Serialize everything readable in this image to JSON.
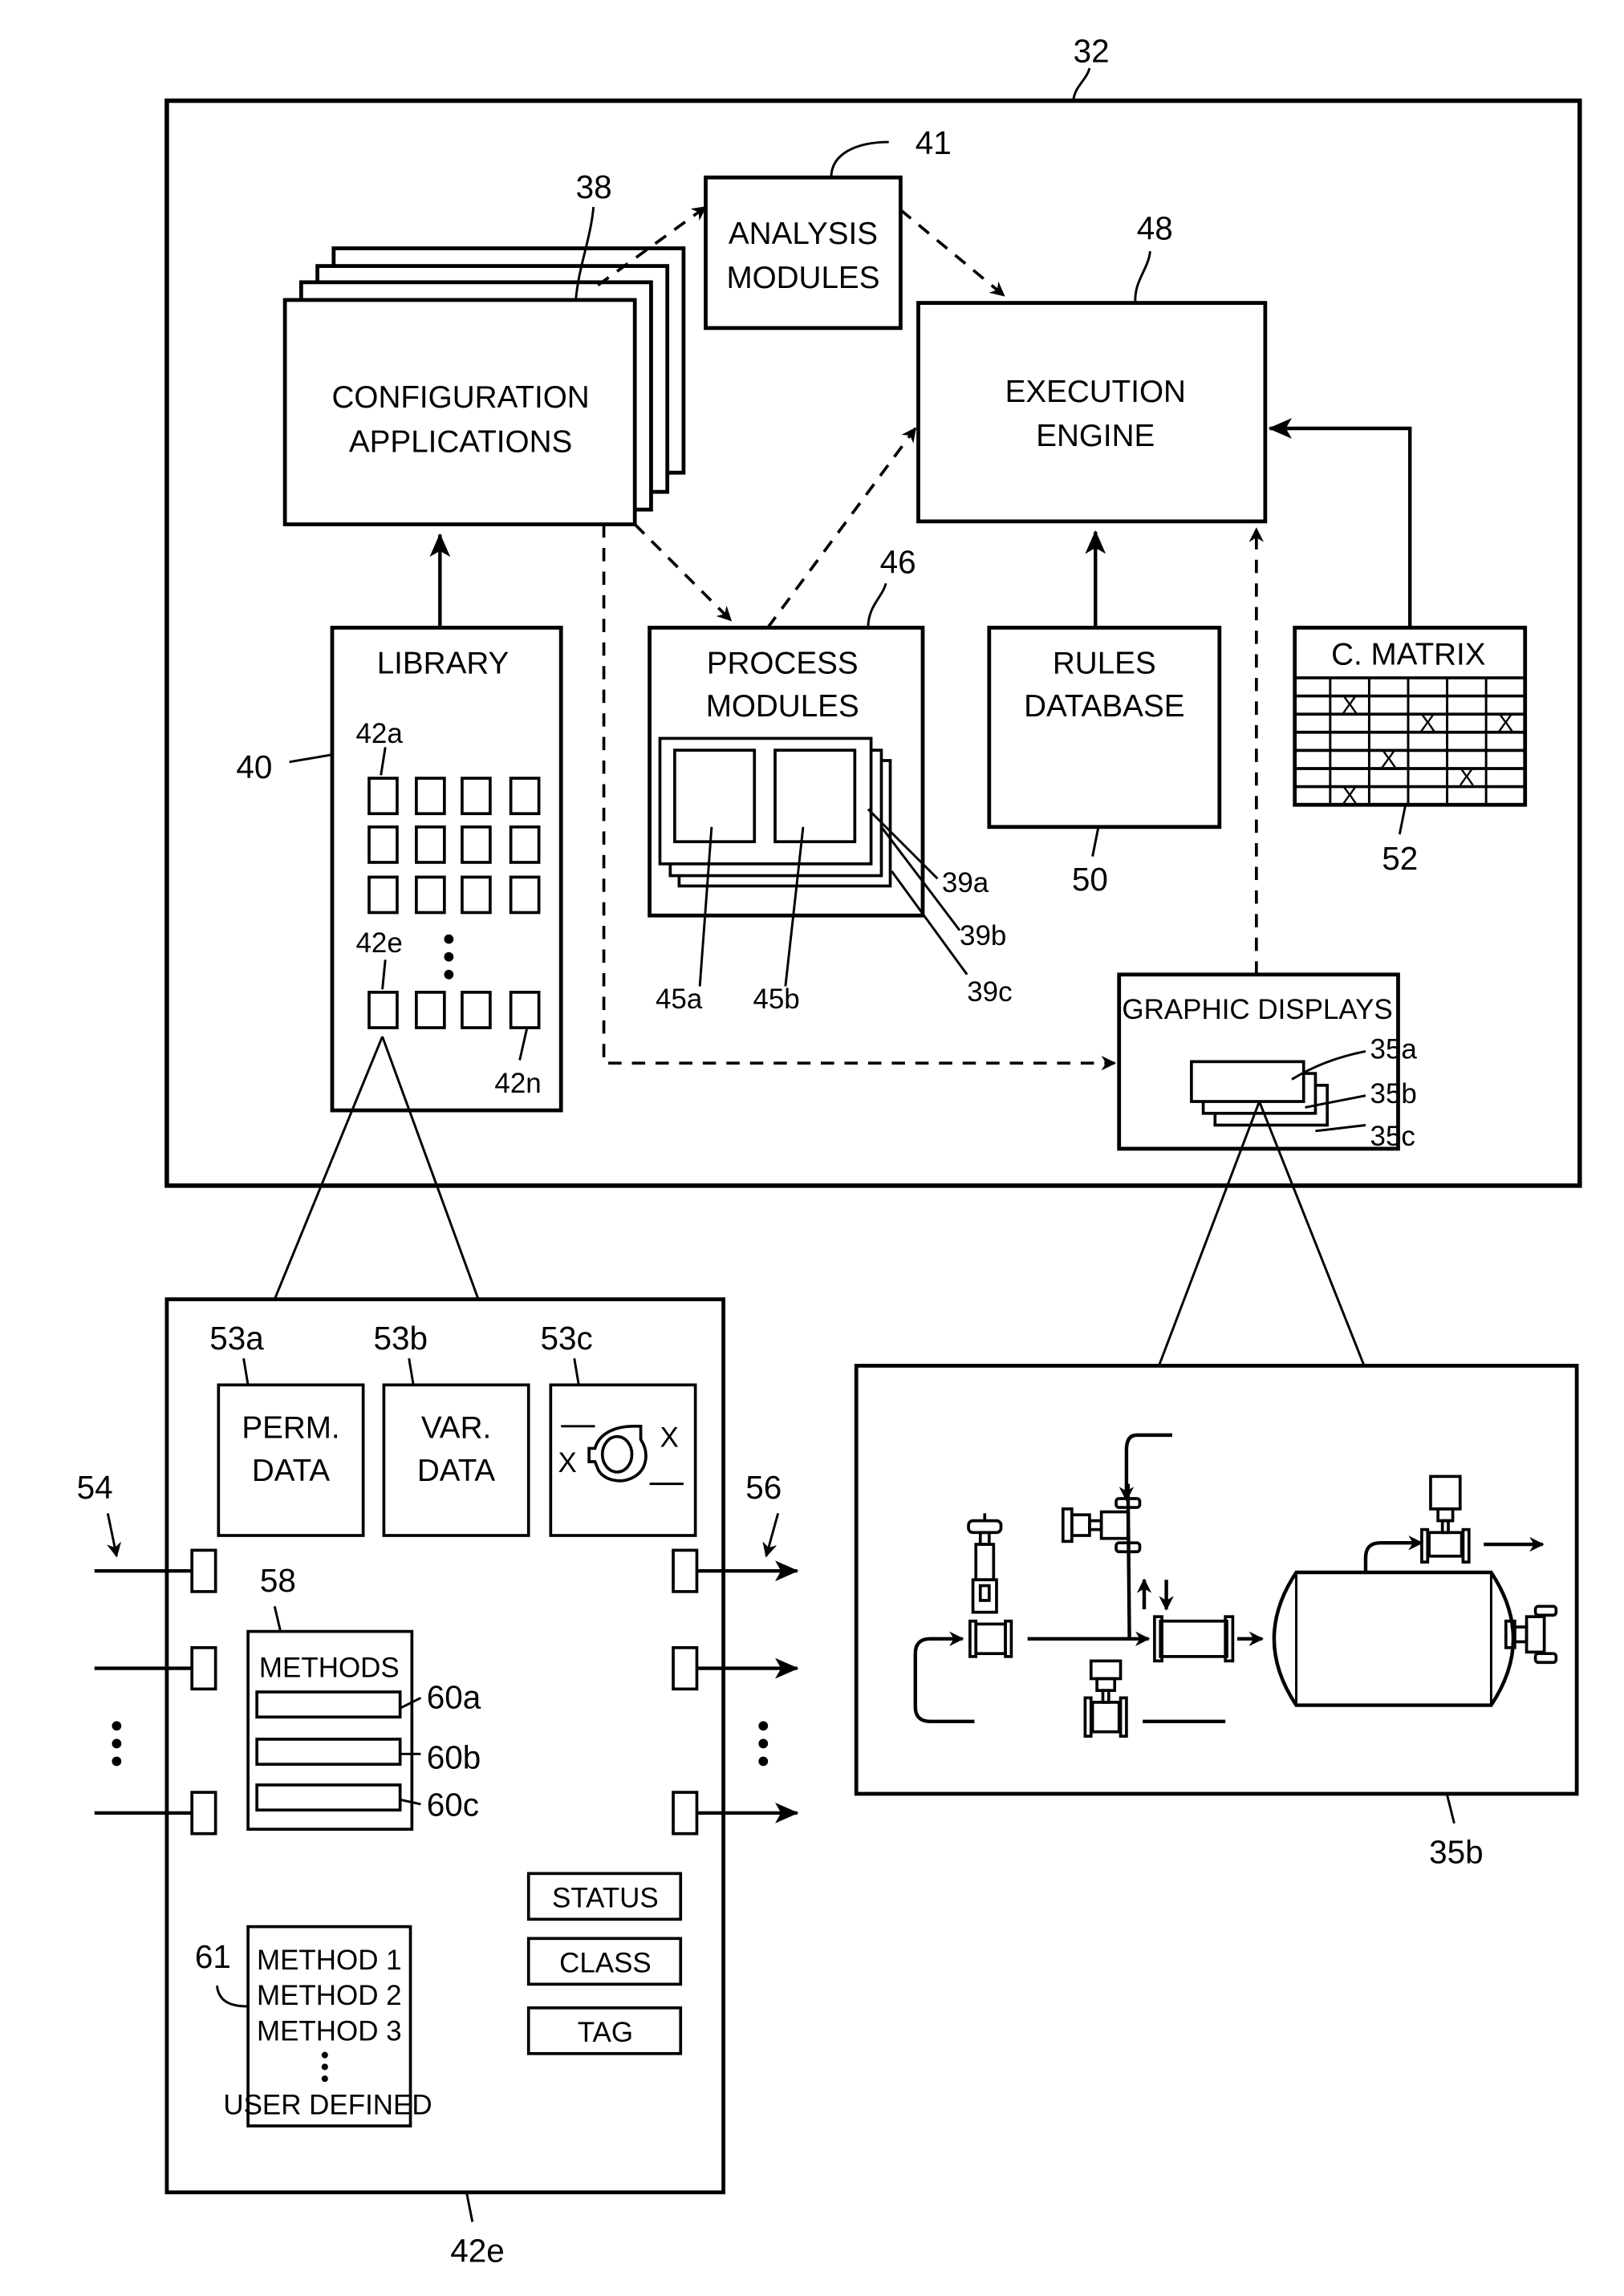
{
  "figure": {
    "system_ref": "32",
    "configuration_applications": {
      "line1": "CONFIGURATION",
      "line2": "APPLICATIONS",
      "ref": "38"
    },
    "analysis_modules": {
      "line1": "ANALYSIS",
      "line2": "MODULES",
      "ref": "41"
    },
    "execution_engine": {
      "line1": "EXECUTION",
      "line2": "ENGINE",
      "ref": "48"
    },
    "library": {
      "title": "LIBRARY",
      "ref": "40",
      "item_first": "42a",
      "item_e": "42e",
      "item_last": "42n"
    },
    "process_modules": {
      "line1": "PROCESS",
      "line2": "MODULES",
      "ref": "46",
      "sub_refs": [
        "45a",
        "45b"
      ],
      "layer_refs": [
        "39a",
        "39b",
        "39c"
      ]
    },
    "rules_database": {
      "line1": "RULES",
      "line2": "DATABASE",
      "ref": "50"
    },
    "cause_matrix": {
      "title": "C. MATRIX",
      "ref": "52",
      "mark": "X",
      "rows": 7,
      "cols": 6,
      "marks": [
        [
          1,
          1
        ],
        [
          2,
          3
        ],
        [
          2,
          5
        ],
        [
          4,
          2
        ],
        [
          5,
          4
        ],
        [
          6,
          1
        ]
      ]
    },
    "graphic_displays": {
      "title": "GRAPHIC DISPLAYS",
      "refs": [
        "35a",
        "35b",
        "35c"
      ]
    },
    "library_item_detail": {
      "ref": "42e",
      "data_blocks": [
        {
          "ref": "53a",
          "line1": "PERM.",
          "line2": "DATA"
        },
        {
          "ref": "53b",
          "line1": "VAR.",
          "line2": "DATA"
        },
        {
          "ref": "53c",
          "icon": "pump-icon",
          "mark": "X"
        }
      ],
      "input_ref": "54",
      "output_ref": "56",
      "methods": {
        "ref": "58",
        "title": "METHODS",
        "slot_refs": [
          "60a",
          "60b",
          "60c"
        ]
      },
      "method_list": {
        "ref": "61",
        "items": [
          "METHOD 1",
          "METHOD 2",
          "METHOD 3"
        ],
        "last": "USER DEFINED"
      },
      "attributes": [
        "STATUS",
        "CLASS",
        "TAG"
      ]
    },
    "graphic_display_detail": {
      "ref": "35b"
    }
  }
}
